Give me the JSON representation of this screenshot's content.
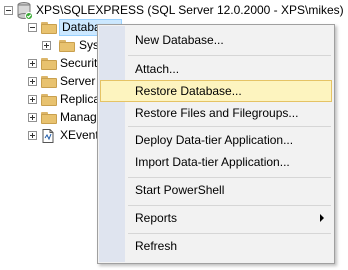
{
  "tree": {
    "server_label": "XPS\\SQLEXPRESS (SQL Server 12.0.2000 - XPS\\mikes)",
    "databases_label": "Databases",
    "system_label": "Syst",
    "security_label": "Security",
    "server_objects_label": "Server O",
    "replication_label": "Replicat",
    "management_label": "Manage",
    "xevent_label": "XEvent"
  },
  "context_menu": {
    "items": [
      {
        "label": "New Database..."
      },
      {
        "label": "Attach..."
      },
      {
        "label": "Restore Database..."
      },
      {
        "label": "Restore Files and Filegroups..."
      },
      {
        "label": "Deploy Data-tier Application..."
      },
      {
        "label": "Import Data-tier Application..."
      },
      {
        "label": "Start PowerShell"
      },
      {
        "label": "Reports"
      },
      {
        "label": "Refresh"
      }
    ],
    "highlighted": "Restore Database..."
  }
}
